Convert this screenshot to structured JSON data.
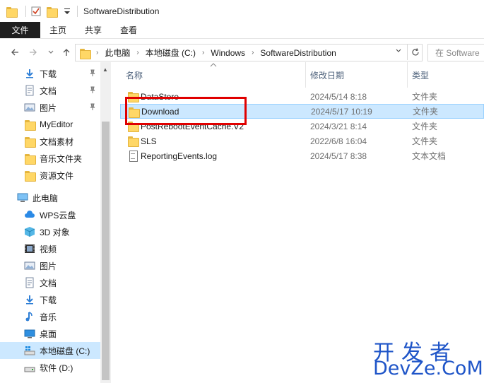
{
  "window": {
    "title": "SoftwareDistribution"
  },
  "ribbon": {
    "tabs": [
      "文件",
      "主页",
      "共享",
      "查看"
    ]
  },
  "address": {
    "crumbs": [
      "此电脑",
      "本地磁盘 (C:)",
      "Windows",
      "SoftwareDistribution"
    ],
    "search_placeholder": "在 Software"
  },
  "nav": {
    "quick": [
      {
        "label": "下载",
        "icon": "download-icon",
        "pinned": true
      },
      {
        "label": "文档",
        "icon": "document-icon",
        "pinned": true
      },
      {
        "label": "图片",
        "icon": "picture-icon",
        "pinned": true
      },
      {
        "label": "MyEditor",
        "icon": "folder-icon",
        "pinned": false
      },
      {
        "label": "文档素材",
        "icon": "folder-icon",
        "pinned": false
      },
      {
        "label": "音乐文件夹",
        "icon": "folder-icon",
        "pinned": false
      },
      {
        "label": "资源文件",
        "icon": "folder-icon",
        "pinned": false
      }
    ],
    "this_pc": "此电脑",
    "pc_items": [
      {
        "label": "WPS云盘",
        "icon": "cloud-icon"
      },
      {
        "label": "3D 对象",
        "icon": "cube-icon"
      },
      {
        "label": "视频",
        "icon": "video-icon"
      },
      {
        "label": "图片",
        "icon": "picture-icon"
      },
      {
        "label": "文档",
        "icon": "document-icon"
      },
      {
        "label": "下载",
        "icon": "download-icon"
      },
      {
        "label": "音乐",
        "icon": "music-icon"
      },
      {
        "label": "桌面",
        "icon": "desktop-icon"
      },
      {
        "label": "本地磁盘 (C:)",
        "icon": "drive-c-icon"
      },
      {
        "label": "软件 (D:)",
        "icon": "drive-icon"
      }
    ]
  },
  "columns": {
    "name": "名称",
    "date": "修改日期",
    "type": "类型"
  },
  "files": [
    {
      "name": "DataStore",
      "date": "2024/5/14 8:18",
      "type": "文件夹",
      "icon": "folder-icon"
    },
    {
      "name": "Download",
      "date": "2024/5/17 10:19",
      "type": "文件夹",
      "icon": "folder-icon"
    },
    {
      "name": "PostRebootEventCache.V2",
      "date": "2024/3/21 8:14",
      "type": "文件夹",
      "icon": "folder-icon"
    },
    {
      "name": "SLS",
      "date": "2022/6/8 16:04",
      "type": "文件夹",
      "icon": "folder-icon"
    },
    {
      "name": "ReportingEvents.log",
      "date": "2024/5/17 8:38",
      "type": "文本文档",
      "icon": "text-file-icon"
    }
  ],
  "watermark": {
    "line1": "开发者",
    "line2": "DevZe.CoM"
  },
  "colors": {
    "selection": "#cce8ff",
    "highlight_box": "#e00000",
    "watermark": "#1f55c8"
  }
}
